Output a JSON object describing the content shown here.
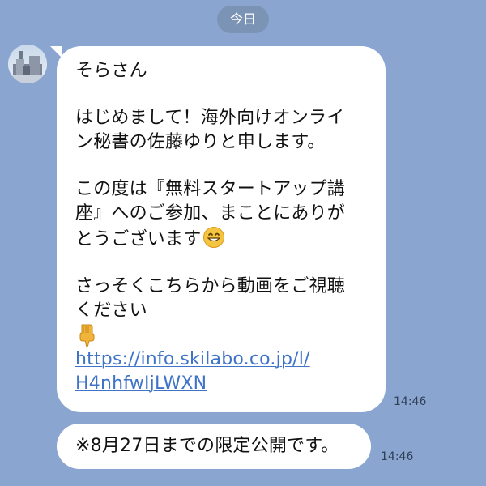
{
  "chat": {
    "date_label": "今日",
    "messages": [
      {
        "lines": [
          "そらさん",
          "",
          "はじめまして！海外向けオンライ",
          "ン秘書の佐藤ゆりと申します。",
          "",
          "この度は『無料スタートアップ講",
          "座』へのご参加、まことにありが",
          "とうございます",
          "",
          "さっそくこちらから動画をご視聴",
          "ください"
        ],
        "link_lines": [
          "https://info.skilabo.co.jp/l/",
          "H4nhfwIjLWXN"
        ],
        "time": "14:46",
        "smile_icon": "grinning-face-icon",
        "point_icon": "pointing-down-icon"
      },
      {
        "text": "※8月27日までの限定公開です。",
        "time": "14:46"
      }
    ]
  },
  "colors": {
    "background": "#8aa6d0",
    "date_chip": "#7b93b5",
    "bubble": "#ffffff",
    "link": "#3e73c8"
  }
}
